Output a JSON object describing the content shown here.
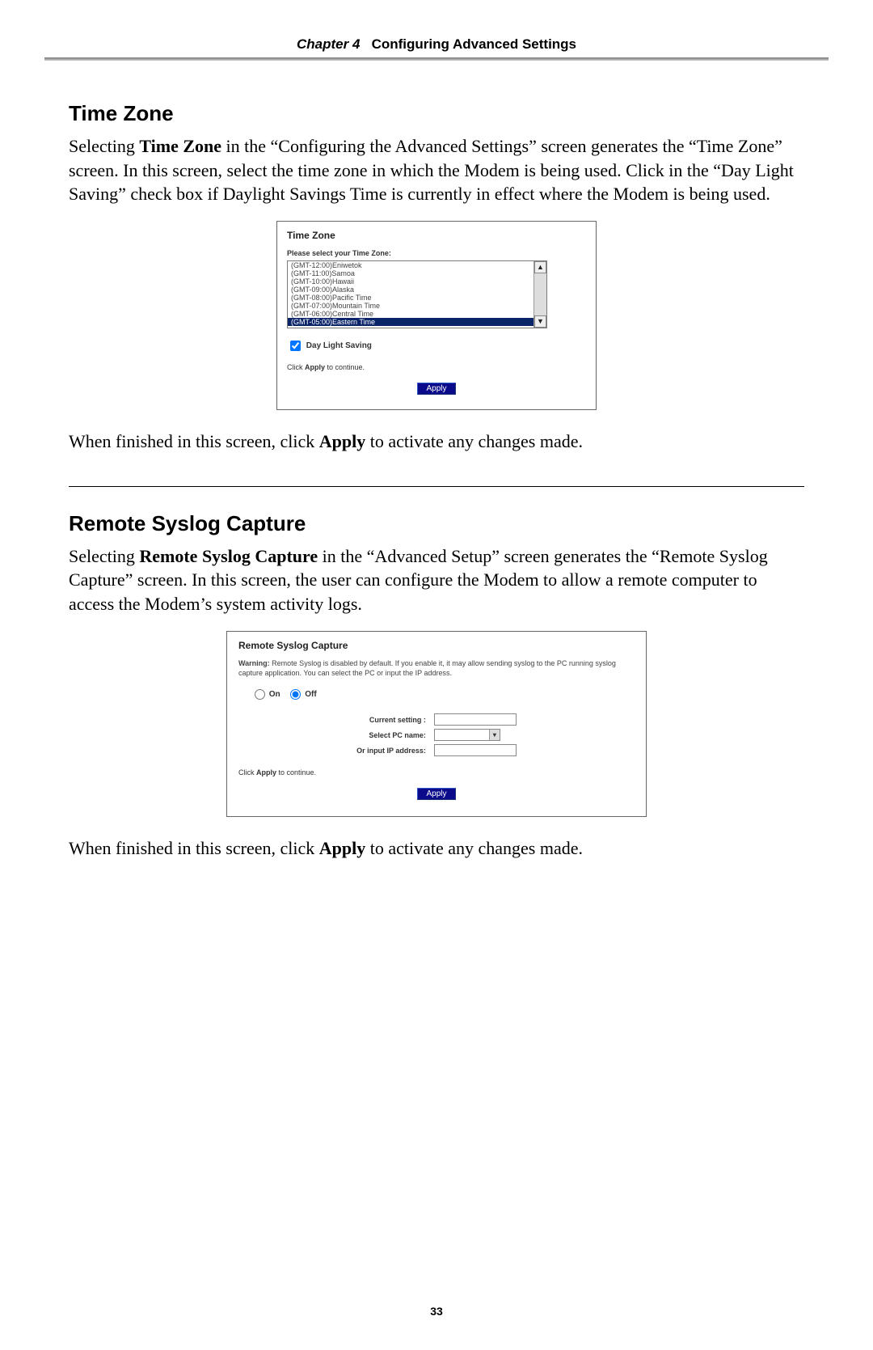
{
  "header": {
    "chapter_label": "Chapter 4",
    "chapter_title": "Configuring Advanced Settings"
  },
  "tz_section": {
    "heading": "Time Zone",
    "para_pre": "Selecting ",
    "para_bold1": "Time Zone",
    "para_mid": " in the “Configuring the Advanced Settings” screen generates the “Time Zone” screen. In this screen, select the time zone in which the Modem is being used. Click in the “Day Light Saving” check box if Daylight Savings Time is currently in effect where the Modem is being used.",
    "after_pre": "When finished in this screen, click ",
    "after_bold": "Apply",
    "after_post": " to activate any changes made."
  },
  "tz_screenshot": {
    "title": "Time Zone",
    "prompt": "Please select your Time Zone:",
    "options": [
      "(GMT-12:00)Eniwetok",
      "(GMT-11:00)Samoa",
      "(GMT-10:00)Hawaii",
      "(GMT-09:00)Alaska",
      "(GMT-08:00)Pacific Time",
      "(GMT-07:00)Mountain Time",
      "(GMT-06:00)Central Time"
    ],
    "selected": "(GMT-05:00)Eastern Time",
    "dls_label": "Day Light Saving",
    "click_apply_pre": "Click ",
    "click_apply_bold": "Apply",
    "click_apply_post": " to continue.",
    "apply_btn": "Apply"
  },
  "sl_section": {
    "heading": "Remote Syslog Capture",
    "para_pre": "Selecting ",
    "para_bold1": "Remote Syslog Capture",
    "para_mid": " in the “Advanced Setup” screen generates the “Remote Syslog Capture” screen. In this screen, the user can configure the Modem to allow a remote computer to access the Modem’s system activity logs.",
    "after_pre": "When finished in this screen, click ",
    "after_bold": "Apply",
    "after_post": " to activate any changes made."
  },
  "sl_screenshot": {
    "title": "Remote Syslog Capture",
    "warn_bold": "Warning:",
    "warn_text": " Remote Syslog is disabled by default. If you enable it, it may allow sending syslog to the PC running syslog capture application. You can select the PC or input the IP address.",
    "radio_on": "On",
    "radio_off": "Off",
    "field_current": "Current setting :",
    "field_pcname": "Select PC name:",
    "field_ip": "Or input IP address:",
    "click_apply_pre": "Click ",
    "click_apply_bold": "Apply",
    "click_apply_post": " to continue.",
    "apply_btn": "Apply"
  },
  "page_number": "33"
}
